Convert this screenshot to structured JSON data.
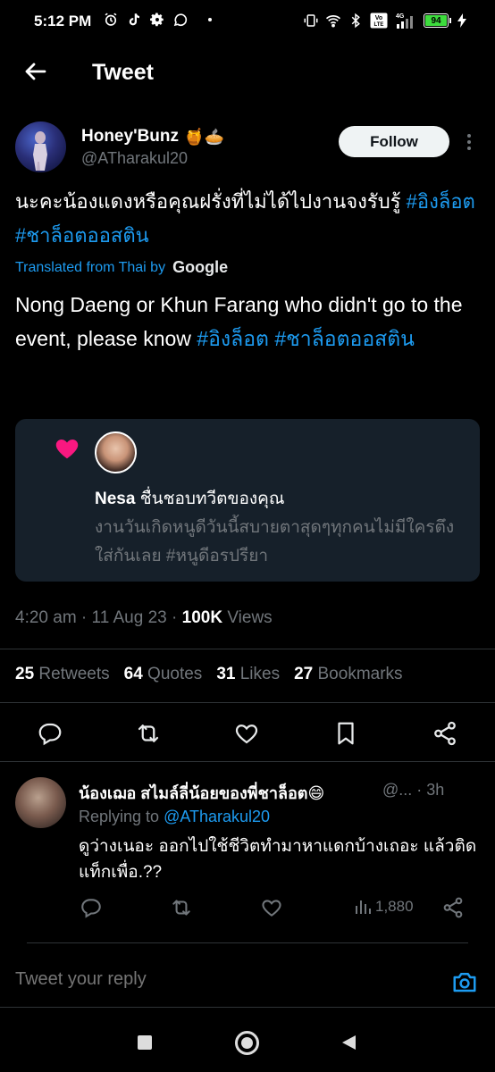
{
  "status_bar": {
    "time": "5:12 PM",
    "battery": "94",
    "icons": [
      "alarm-icon",
      "tiktok-icon",
      "gear-icon",
      "whatsapp-icon",
      "vibrate-icon",
      "wifi-icon",
      "bluetooth-icon",
      "volte-icon",
      "signal-icon",
      "charging-icon"
    ]
  },
  "header": {
    "title": "Tweet"
  },
  "author": {
    "name": "Honey'Bunz",
    "name_emoji": "🍯🥧",
    "handle": "@ATharakul20",
    "follow_label": "Follow"
  },
  "tweet": {
    "text": "นะคะน้องแดงหรือคุณฝรั่งที่ไม่ได้ไปงานจงรับรู้ ",
    "hashtags": [
      "#อิงล็อต",
      "#ชาล็อตออสติน"
    ],
    "translated_label": "Translated from Thai by",
    "translator": "Google",
    "translation_text": "Nong Daeng or Khun Farang who didn't go to the event, please know ",
    "translation_hashtags": [
      "#อิงล็อต",
      "#ชาล็อตออสติน"
    ]
  },
  "liked_card": {
    "name": "Nesa",
    "action": " ชื่นชอบทวีตของคุณ",
    "text": "งานวันเกิดหนูดีวันนี้สบายตาสุดๆทุกคนไม่มีใครตึงใส่กันเลย #หนูดีอรปรียา",
    "accent_color": "#f91880"
  },
  "meta": {
    "time": "4:20 am",
    "sep1": " · ",
    "date": "11 Aug 23",
    "sep2": " · ",
    "views_count": "100K",
    "views_label": " Views"
  },
  "stats": {
    "retweets_count": "25",
    "retweets_label": " Retweets",
    "quotes_count": "64",
    "quotes_label": " Quotes",
    "likes_count": "31",
    "likes_label": " Likes",
    "bookmarks_count": "27",
    "bookmarks_label": " Bookmarks"
  },
  "reply": {
    "name": "น้องเฌอ สไมล์ลี่น้อยของพี่ชาล็อต😄",
    "handle": "@... · 3h",
    "replying_to_label": "Replying to ",
    "replying_to_handle": "@ATharakul20",
    "text": "ดูว่างเนอะ ออกไปใช้ชีวิตทำมาหาแดกบ้างเถอะ แล้วติดแท็กเพื่อ.??",
    "views": "1,880"
  },
  "composer": {
    "placeholder": "Tweet your reply"
  },
  "colors": {
    "accent": "#1d9bf0",
    "muted": "#71767b",
    "background": "#000000",
    "card": "#16202a"
  }
}
